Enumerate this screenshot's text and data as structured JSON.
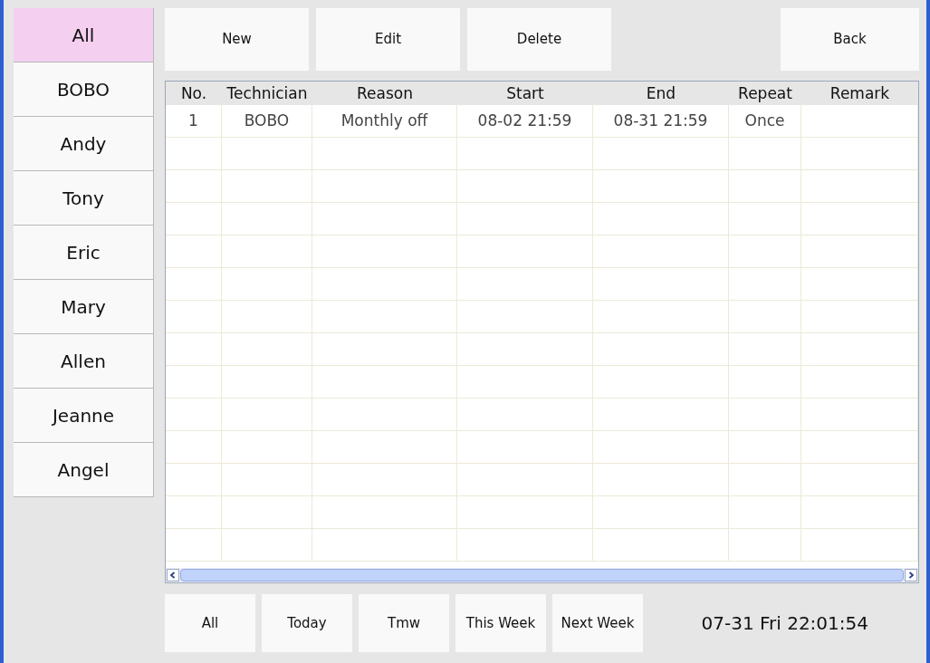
{
  "sidebar": {
    "items": [
      {
        "label": "All",
        "selected": true
      },
      {
        "label": "BOBO",
        "selected": false
      },
      {
        "label": "Andy",
        "selected": false
      },
      {
        "label": "Tony",
        "selected": false
      },
      {
        "label": "Eric",
        "selected": false
      },
      {
        "label": "Mary",
        "selected": false
      },
      {
        "label": "Allen",
        "selected": false
      },
      {
        "label": "Jeanne",
        "selected": false
      },
      {
        "label": "Angel",
        "selected": false
      }
    ]
  },
  "toolbar": {
    "left_buttons": [
      "New",
      "Edit",
      "Delete"
    ],
    "right_buttons": [
      "Back"
    ]
  },
  "table": {
    "columns": [
      "No.",
      "Technician",
      "Reason",
      "Start",
      "End",
      "Repeat",
      "Remark"
    ],
    "rows": [
      [
        "1",
        "BOBO",
        "Monthly off",
        "08-02 21:59",
        "08-31 21:59",
        "Once",
        ""
      ]
    ]
  },
  "filters": [
    "All",
    "Today",
    "Tmw",
    "This Week",
    "Next Week"
  ],
  "clock": "07-31 Fri 22:01:54"
}
